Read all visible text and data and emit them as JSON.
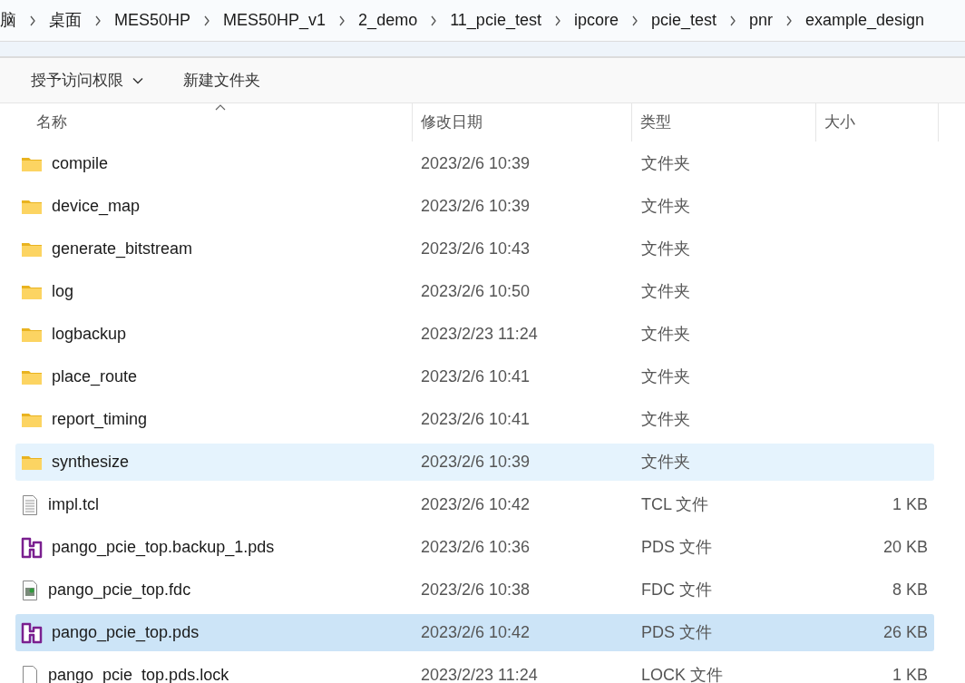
{
  "breadcrumb": [
    "脑",
    "桌面",
    "MES50HP",
    "MES50HP_v1",
    "2_demo",
    "11_pcie_test",
    "ipcore",
    "pcie_test",
    "pnr",
    "example_design"
  ],
  "toolbar": {
    "share": "授予访问权限",
    "new_folder": "新建文件夹"
  },
  "columns": [
    {
      "label": "名称",
      "sorted": true
    },
    {
      "label": "修改日期",
      "sorted": false
    },
    {
      "label": "类型",
      "sorted": false
    },
    {
      "label": "大小",
      "sorted": false
    }
  ],
  "rows": [
    {
      "kind": "folder",
      "name": "compile",
      "date": "2023/2/6 10:39",
      "type": "文件夹",
      "selected": false,
      "hovered": false
    },
    {
      "kind": "folder",
      "name": "device_map",
      "date": "2023/2/6 10:39",
      "type": "文件夹",
      "selected": false,
      "hovered": false
    },
    {
      "kind": "folder",
      "name": "generate_bitstream",
      "date": "2023/2/6 10:43",
      "type": "文件夹",
      "selected": false,
      "hovered": false
    },
    {
      "kind": "folder",
      "name": "log",
      "date": "2023/2/6 10:50",
      "type": "文件夹",
      "selected": false,
      "hovered": false
    },
    {
      "kind": "folder",
      "name": "logbackup",
      "date": "2023/2/23 11:24",
      "type": "文件夹",
      "selected": false,
      "hovered": false
    },
    {
      "kind": "folder",
      "name": "place_route",
      "date": "2023/2/6 10:41",
      "type": "文件夹",
      "selected": false,
      "hovered": false
    },
    {
      "kind": "folder",
      "name": "report_timing",
      "date": "2023/2/6 10:41",
      "type": "文件夹",
      "selected": false,
      "hovered": false
    },
    {
      "kind": "folder",
      "name": "synthesize",
      "date": "2023/2/6 10:39",
      "type": "文件夹",
      "selected": false,
      "hovered": true
    },
    {
      "kind": "text",
      "name": "impl.tcl",
      "date": "2023/2/6 10:42",
      "type": "TCL 文件",
      "size": "1 KB",
      "selected": false,
      "hovered": false
    },
    {
      "kind": "pds",
      "name": "pango_pcie_top.backup_1.pds",
      "date": "2023/2/6 10:36",
      "type": "PDS 文件",
      "size": "20 KB",
      "selected": false,
      "hovered": false
    },
    {
      "kind": "fdc",
      "name": "pango_pcie_top.fdc",
      "date": "2023/2/6 10:38",
      "type": "FDC 文件",
      "size": "8 KB",
      "selected": false,
      "hovered": false
    },
    {
      "kind": "pds",
      "name": "pango_pcie_top.pds",
      "date": "2023/2/6 10:42",
      "type": "PDS 文件",
      "size": "26 KB",
      "selected": true,
      "hovered": false
    },
    {
      "kind": "blank",
      "name": "pango_pcie_top.pds.lock",
      "date": "2023/2/23 11:24",
      "type": "LOCK 文件",
      "size": "1 KB",
      "selected": false,
      "hovered": false
    }
  ]
}
